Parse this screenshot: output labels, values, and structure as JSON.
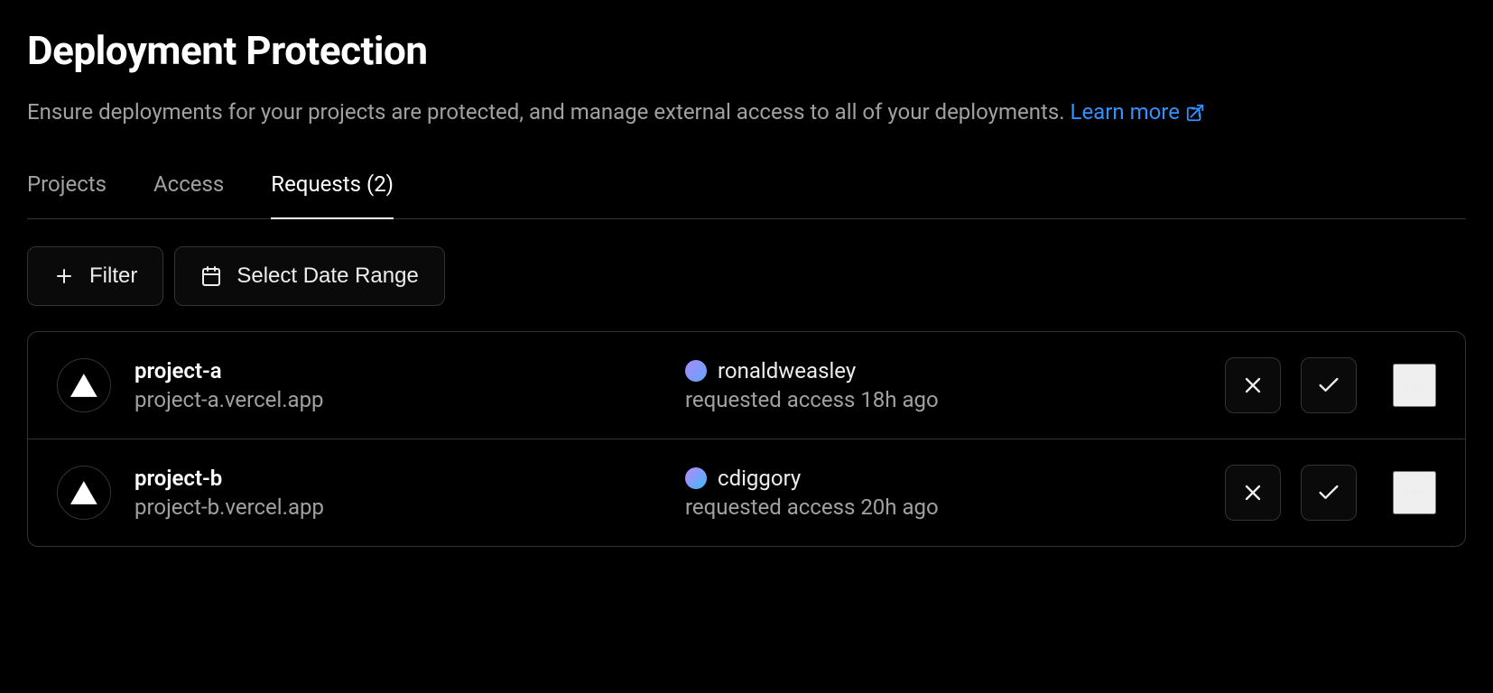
{
  "header": {
    "title": "Deployment Protection",
    "description": "Ensure deployments for your projects are protected, and manage external access to all of your deployments. ",
    "learn_more": "Learn more"
  },
  "tabs": {
    "projects": "Projects",
    "access": "Access",
    "requests": "Requests (2)"
  },
  "toolbar": {
    "filter": "Filter",
    "date_range": "Select Date Range"
  },
  "avatars": {
    "gradient1": "linear-gradient(135deg, #a78bfa 0%, #60a5fa 100%)",
    "gradient2": "linear-gradient(135deg, #c084fc 0%, #38bdf8 100%)"
  },
  "requests": [
    {
      "project_name": "project-a",
      "project_url": "project-a.vercel.app",
      "requester": "ronaldweasley",
      "meta": "requested access 18h ago"
    },
    {
      "project_name": "project-b",
      "project_url": "project-b.vercel.app",
      "requester": "cdiggory",
      "meta": "requested access 20h ago"
    }
  ]
}
